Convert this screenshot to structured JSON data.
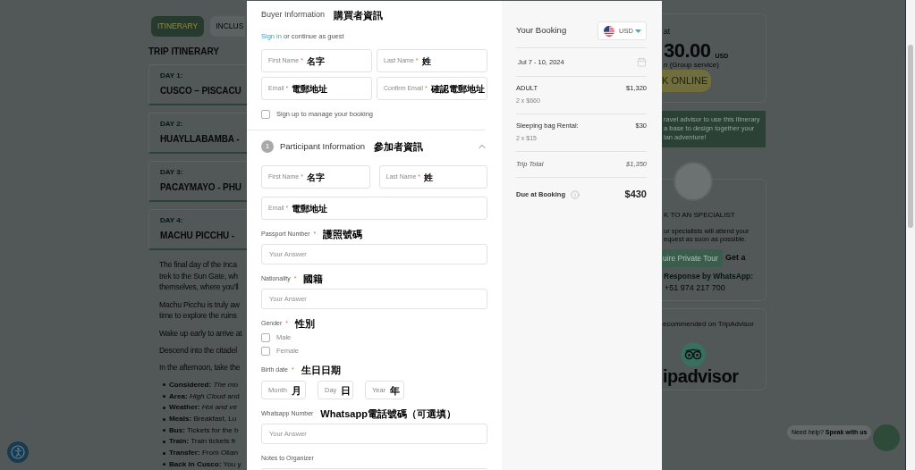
{
  "background_page": {
    "tabs": [
      {
        "label": "ITINERARY",
        "selected": true
      },
      {
        "label": "INCLUS",
        "selected": false
      }
    ],
    "heading": "TRIP ITINERARY",
    "days": [
      {
        "label": "DAY 1:",
        "title": "CUSCO – PISCACU"
      },
      {
        "label": "DAY 2:",
        "title": "HUAYLLABAMBA -"
      },
      {
        "label": "DAY 3:",
        "title": "PACAYMAYO - PHU"
      },
      {
        "label": "DAY 4:",
        "title": "MACHU PICCHU -"
      }
    ],
    "paragraphs": [
      [
        "The final day of the Inca",
        "trek to the Sun Gate, wh",
        "themselves, where you'll"
      ],
      [
        "Machu Picchu is truly aw",
        "time to explore the ruins"
      ],
      [
        "Wake up early to arrive at"
      ],
      [
        "Descend into the citadel"
      ],
      [
        "In the afternoon, take the"
      ]
    ],
    "details": [
      "**Considered:** *The mo*",
      "**Area:** *High Cloud* and",
      "**Weather:** *Hot and ve*",
      "**Meals:** Breakfast, Lu",
      "**Bus:** Tickets for the b",
      "**Train:** Train tickets fr",
      "**Transfer:** From Ollan",
      "**Back in Cusco:** You y"
    ],
    "price_card": {
      "prefix": "at",
      "price": "30.00",
      "currency": "USD",
      "note": "n (Group service)",
      "button": "K ONLINE"
    },
    "advisor_banner": [
      "ravel advisor to use this itinerary",
      "a base to design together your",
      "ian adventure!"
    ],
    "specialist_card": {
      "title": "K TO AN SPECIALIST",
      "text": [
        "ur specialists will attend your",
        "equest as soon as possible."
      ],
      "button": "uire Private Tour",
      "whatsapp_lead": "Get a",
      "whatsapp_label": "Response by WhatsApp:",
      "phone": "+51 974 217 700"
    },
    "tripadvisor_card": {
      "title": "ecommended on TripAdvisor",
      "logo_text": "ipadvisor"
    },
    "chat_prompt": "Need help? **Speak with us**"
  },
  "booking_modal": {
    "buyer": {
      "title": "Buyer Information",
      "annotation": "購買者資訊",
      "sign_in": {
        "link": "Sign in",
        "rest": "or continue as guest"
      },
      "fields": [
        {
          "label": "First Name",
          "mark": "*",
          "annotation": "名字"
        },
        {
          "label": "Last Name",
          "mark": "*",
          "annotation": "姓"
        },
        {
          "label": "Email",
          "mark": "*",
          "annotation": "電郵地址"
        },
        {
          "label": "Confirm Email",
          "mark": "*",
          "annotation": "確認電郵地址"
        }
      ],
      "signup": {
        "label": "Sign up to manage your booking",
        "checked": false
      }
    },
    "participant": {
      "number": "1",
      "title": "Participant Information",
      "annotation": "參加者資訊",
      "expanded": true,
      "fields": [
        {
          "label": "First Name",
          "mark": "*",
          "annotation": "名字"
        },
        {
          "label": "Last Name",
          "mark": "*",
          "annotation": "姓"
        },
        {
          "label": "Email",
          "mark": "*",
          "annotation": "電郵地址"
        }
      ],
      "questions": [
        {
          "kind": "text",
          "label": "Passport Number",
          "mark": "*",
          "annotation": "護照號碼",
          "placeholder": "Your Answer"
        },
        {
          "kind": "text",
          "label": "Nationality",
          "mark": "*",
          "annotation": "國籍",
          "placeholder": "Your Answer"
        },
        {
          "kind": "choice",
          "label": "Gender",
          "mark": "*",
          "annotation": "性別",
          "options": [
            {
              "label": "Male",
              "checked": false
            },
            {
              "label": "Female",
              "checked": false
            }
          ]
        },
        {
          "kind": "date",
          "label": "Birth date",
          "mark": "*",
          "annotation": "生日日期",
          "parts": [
            {
              "placeholder": "Month",
              "annotation": "月"
            },
            {
              "placeholder": "Day",
              "annotation": "日"
            },
            {
              "placeholder": "Year",
              "annotation": "年"
            }
          ]
        },
        {
          "kind": "text",
          "label": "Whatsapp Number",
          "annotation": "Whatsapp電話號碼（可選填）",
          "placeholder": "Your Answer"
        },
        {
          "kind": "text",
          "label": "Notes to Organizer"
        }
      ]
    },
    "summary": {
      "title": "Your Booking",
      "currency": "USD",
      "dates": "Jul 7 - 10, 2024",
      "items": [
        {
          "name": "ADULT",
          "detail": "2 x $660",
          "amount": "$1,320"
        },
        {
          "name": "Sleeping bag Rental:",
          "detail": "2 x $15",
          "amount": "$30"
        }
      ],
      "total": {
        "label": "Trip Total",
        "amount": "$1,350"
      },
      "due": {
        "label": "Due at Booking",
        "amount": "$430"
      }
    }
  }
}
